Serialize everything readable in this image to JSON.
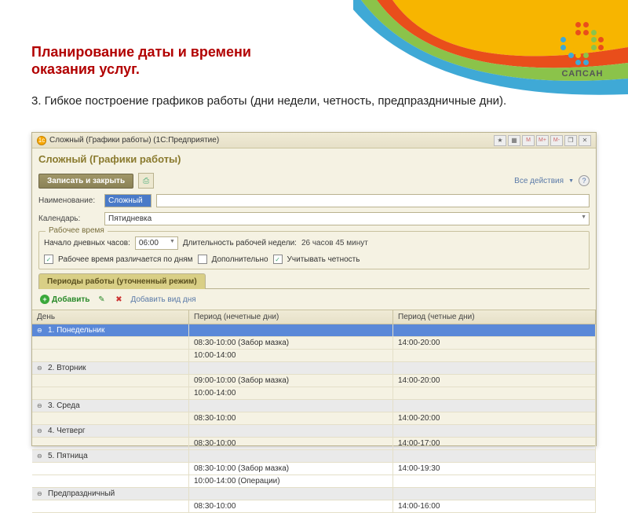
{
  "slide": {
    "title": "Планирование даты и времени оказания услуг.",
    "subtitle": "3. Гибкое построение графиков работы (дни недели, четность, предпраздничные дни)."
  },
  "brand": "САПСАН",
  "titlebar": {
    "text": "Сложный (Графики работы)  (1С:Предприятие)"
  },
  "header": "Сложный (Графики работы)",
  "toolbar": {
    "save": "Записать и закрыть",
    "all_actions": "Все действия"
  },
  "form": {
    "name_label": "Наименование:",
    "name_value": "Сложный",
    "calendar_label": "Календарь:",
    "calendar_value": "Пятидневка"
  },
  "worktime": {
    "legend": "Рабочее время",
    "start_label": "Начало дневных часов:",
    "start_value": "06:00",
    "duration_label": "Длительность рабочей недели:",
    "duration_value": "26 часов 45 минут",
    "chk_diff": "Рабочее время различается по дням",
    "chk_additional": "Дополнительно",
    "chk_parity": "Учитывать четность"
  },
  "tabs": {
    "periods": "Периоды работы (уточненный режим)"
  },
  "actions": {
    "add": "Добавить",
    "add_daytype": "Добавить вид дня"
  },
  "table": {
    "h1": "День",
    "h2": "Период (нечетные дни)",
    "h3": "Период (четные дни)",
    "rows": [
      {
        "type": "day",
        "sel": true,
        "label": "1. Понедельник"
      },
      {
        "type": "data",
        "p1": "08:30-10:00 (Забор мазка)",
        "p2": "14:00-20:00"
      },
      {
        "type": "data",
        "p1": "10:00-14:00",
        "p2": ""
      },
      {
        "type": "day",
        "label": "2. Вторник"
      },
      {
        "type": "data",
        "p1": "09:00-10:00 (Забор мазка)",
        "p2": "14:00-20:00"
      },
      {
        "type": "data",
        "p1": "10:00-14:00",
        "p2": ""
      },
      {
        "type": "day",
        "label": "3. Среда"
      },
      {
        "type": "data",
        "p1": "08:30-10:00",
        "p2": "14:00-20:00"
      },
      {
        "type": "day",
        "label": "4. Четверг"
      },
      {
        "type": "data",
        "p1": "08:30-10:00",
        "p2": "14:00-17:00"
      },
      {
        "type": "day",
        "label": "5. Пятница"
      },
      {
        "type": "data",
        "p1": "08:30-10:00 (Забор мазка)",
        "p2": "14:00-19:30"
      },
      {
        "type": "data",
        "p1": "10:00-14:00 (Операции)",
        "p2": ""
      },
      {
        "type": "day",
        "label": "Предпраздничный"
      },
      {
        "type": "data",
        "p1": "08:30-10:00",
        "p2": "14:00-16:00"
      }
    ]
  }
}
